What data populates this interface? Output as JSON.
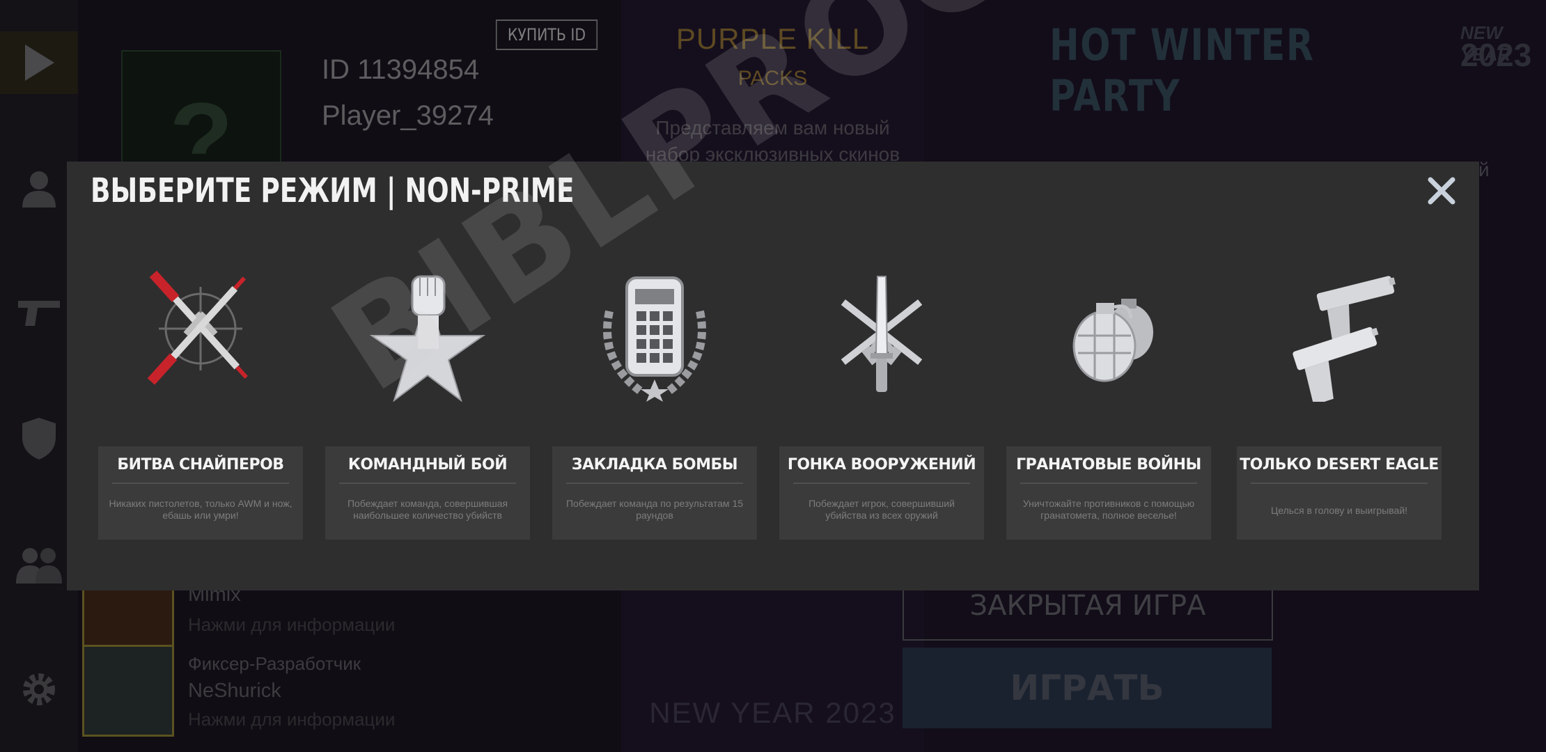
{
  "background": {
    "sidebar": {
      "icons": [
        "play-icon",
        "person-icon",
        "pistol-icon",
        "shield-icon",
        "group-icon",
        "gear-icon"
      ]
    },
    "profile": {
      "buy_id_label": "КУПИТЬ ID",
      "avatar_placeholder": "?",
      "player_id": "ID 11394854",
      "player_name": "Player_39274",
      "friends": [
        {
          "role": "",
          "name": "Mimix",
          "hint": "Нажми для информации"
        },
        {
          "role": "Фиксер-Разработчик",
          "name": "NeShurick",
          "hint": "Нажми для информации"
        }
      ]
    },
    "news": {
      "title": "PURPLE KILL",
      "subtitle": "PACKS",
      "description": "Представляем вам новый набор эксклюзивных скинов",
      "bottom_text": "NEW YEAR 2023"
    },
    "event": {
      "title": "HOT WINTER PARTY",
      "badge_line1": "NEW YEAR",
      "badge_line2": "2023",
      "side_fragment": "й",
      "closed_game_label": "ЗАКРЫТАЯ ИГРА",
      "play_label": "ИГРАТЬ"
    }
  },
  "modal": {
    "title": "ВЫБЕРИТЕ РЕЖИМ  |  NON-PRIME",
    "modes": [
      {
        "name": "БИТВА СНАЙПЕРОВ",
        "description": "Никаких пистолетов, только AWM и нож, ебашь или умри!",
        "icon": "crossed-sniper-rifles-icon"
      },
      {
        "name": "КОМАНДНЫЙ БОЙ",
        "description": "Побеждает команда, совершившая наибольшее количество убийств",
        "icon": "fist-star-icon"
      },
      {
        "name": "ЗАКЛАДКА БОМБЫ",
        "description": "Побеждает команда по результатам 15 раундов",
        "icon": "bomb-laurel-icon"
      },
      {
        "name": "ГОНКА ВООРУЖЕНИЙ",
        "description": "Побеждает игрок, совершивший убийства из всех оружий",
        "icon": "knife-rifles-icon"
      },
      {
        "name": "ГРАНАТОВЫЕ ВОЙНЫ",
        "description": "Уничтожайте противников с помощью гранатомета, полное веселье!",
        "icon": "grenades-icon"
      },
      {
        "name": "ТОЛЬКО DESERT EAGLE",
        "description": "Целься в голову и выигрывай!",
        "icon": "desert-eagle-pistols-icon"
      }
    ]
  },
  "watermark": "BIBLPROG.org.ua",
  "colors": {
    "modal_bg": "#2e2e2f",
    "card_bg": "#3b3b3c",
    "accent_red": "#c8232a",
    "news_gold": "#5e4a22"
  }
}
